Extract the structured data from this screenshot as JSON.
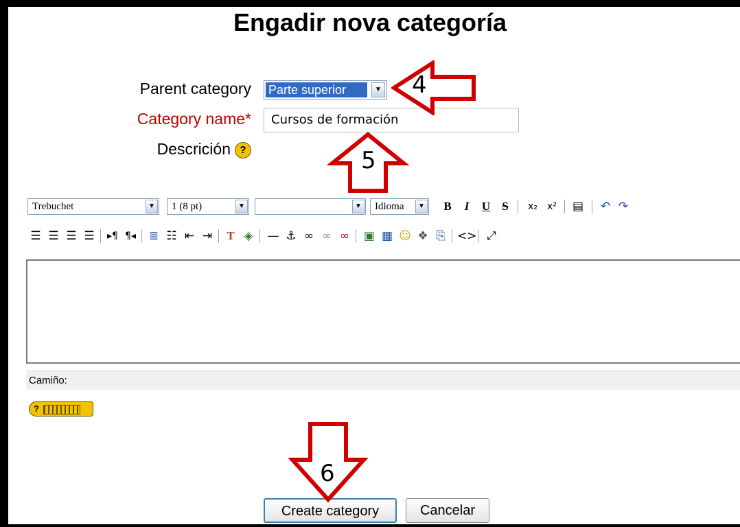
{
  "page": {
    "title": "Engadir nova categoría"
  },
  "form": {
    "parent_label": "Parent category",
    "parent_value": "Parte superior",
    "name_label": "Category name*",
    "name_value": "Cursos de formación",
    "description_label": "Descrición"
  },
  "editor": {
    "font_family": "Trebuchet",
    "font_size": "1 (8 pt)",
    "format": "",
    "language": "Idioma",
    "path_label": "Camiño:",
    "toolbar_row1": [
      "bold-icon",
      "italic-icon",
      "underline-icon",
      "strikethrough-icon",
      "subscript-icon",
      "superscript-icon",
      "paste-word-icon",
      "undo-icon",
      "redo-icon"
    ],
    "toolbar_row2": [
      "align-left-icon",
      "align-center-icon",
      "align-right-icon",
      "justify-icon",
      "ltr-icon",
      "rtl-icon",
      "ordered-list-icon",
      "unordered-list-icon",
      "outdent-icon",
      "indent-icon",
      "text-color-icon",
      "bg-color-icon",
      "horizontal-rule-icon",
      "anchor-icon",
      "link-icon",
      "unlink-icon",
      "nolink-icon",
      "image-icon",
      "table-icon",
      "smiley-icon",
      "special-char-icon",
      "search-replace-icon",
      "html-source-icon",
      "fullscreen-icon"
    ]
  },
  "buttons": {
    "create": "Create category",
    "cancel": "Cancelar"
  },
  "annotations": {
    "arrow_4": "4",
    "arrow_5": "5",
    "arrow_6": "6"
  },
  "colors": {
    "required": "#c00000",
    "selection": "#316ac5",
    "arrow": "#d00000",
    "help_icon": "#f2c200",
    "primary_border": "#3c7fb1"
  }
}
